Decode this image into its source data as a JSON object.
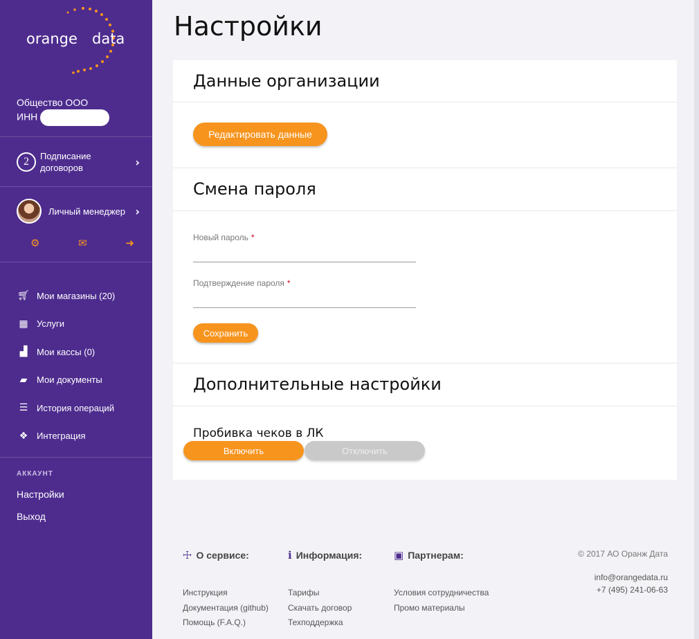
{
  "sidebar": {
    "logo": {
      "left": "orange",
      "right": "data"
    },
    "org_name": "Общество ООО",
    "inn_label": "ИНН",
    "contracts": {
      "count": "2",
      "label": "Подписание договоров"
    },
    "manager_label": "Личный менеджер",
    "quick_icons": [
      "gears-icon",
      "envelope-icon",
      "sign-out-icon"
    ],
    "menu": [
      {
        "icon": "cart-icon",
        "label": "Мои магазины (20)"
      },
      {
        "icon": "calculator-icon",
        "label": "Услуги"
      },
      {
        "icon": "register-icon",
        "label": "Мои кассы (0)"
      },
      {
        "icon": "folder-icon",
        "label": "Мои документы"
      },
      {
        "icon": "coins-icon",
        "label": "История операций"
      },
      {
        "icon": "cubes-icon",
        "label": "Интеграция"
      }
    ],
    "account_heading": "АККАУНТ",
    "settings_link": "Настройки",
    "logout_link": "Выход"
  },
  "main": {
    "title": "Настройки",
    "org_section": {
      "heading": "Данные организации",
      "edit_button": "Редактировать данные"
    },
    "password_section": {
      "heading": "Смена пароля",
      "new_password_label": "Новый пароль",
      "confirm_password_label": "Подтверждение пароля",
      "required_mark": "*",
      "save_button": "Сохранить"
    },
    "extra_section": {
      "heading": "Дополнительные настройки",
      "receipt_label": "Пробивка чеков в ЛК",
      "enable_button": "Включить",
      "disable_button": "Отключить"
    }
  },
  "footer": {
    "about": {
      "heading": "О сервисе:",
      "links": [
        "Инструкция",
        "Документация (github)",
        "Помощь (F.A.Q.)"
      ]
    },
    "info": {
      "heading": "Информация:",
      "links": [
        "Тарифы",
        "Скачать договор",
        "Техподдержка"
      ]
    },
    "partners": {
      "heading": "Партнерам:",
      "links": [
        "Условия сотрудничества",
        "Промо материалы"
      ]
    },
    "copyright": "© 2017 АО Оранж Дата",
    "email": "info@orangedata.ru",
    "phone": "+7 (495) 241-06-63"
  },
  "colors": {
    "sidebar": "#4e2c8e",
    "accent": "#f7941e",
    "disabled": "#c9c9c9"
  }
}
